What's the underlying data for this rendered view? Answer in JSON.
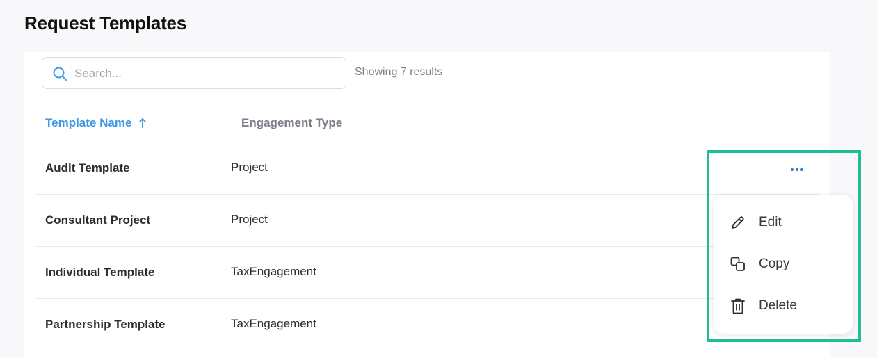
{
  "header": {
    "title": "Request Templates"
  },
  "search": {
    "placeholder": "Search...",
    "results_text": "Showing 7 results"
  },
  "table": {
    "columns": [
      {
        "label": "Template Name",
        "sort": "ascending"
      },
      {
        "label": "Engagement Type"
      }
    ],
    "rows": [
      {
        "name": "Audit Template",
        "type": "Project"
      },
      {
        "name": "Consultant Project",
        "type": "Project"
      },
      {
        "name": "Individual Template",
        "type": "TaxEngagement"
      },
      {
        "name": "Partnership Template",
        "type": "TaxEngagement"
      }
    ]
  },
  "row_menu": {
    "items": [
      {
        "label": "Edit",
        "icon": "pencil-icon"
      },
      {
        "label": "Copy",
        "icon": "copy-icon"
      },
      {
        "label": "Delete",
        "icon": "trash-icon"
      }
    ]
  },
  "colors": {
    "accent": "#3f98e4",
    "highlight": "#1fbf95",
    "more_dots": "#2f7fc9"
  }
}
